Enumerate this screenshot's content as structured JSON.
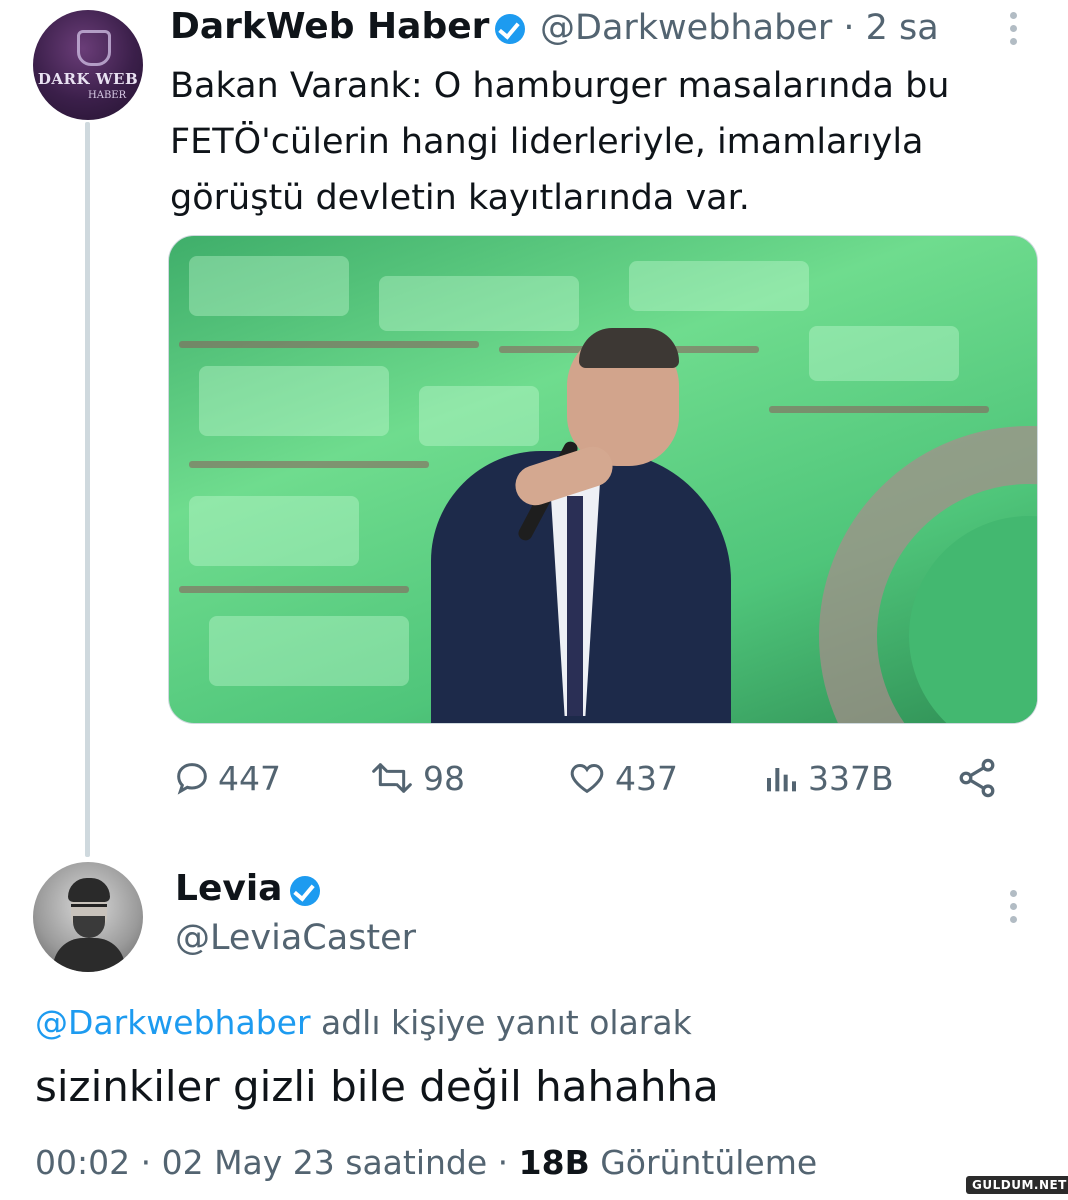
{
  "tweet": {
    "author_name": "DarkWeb Haber",
    "handle": "@Darkwebhaber",
    "time": "· 2 sa",
    "avatar_text": "DARK WEB",
    "avatar_sub": "HABER",
    "text": "Bakan Varank: O hamburger masalarında bu FETÖ'cülerin hangi liderleriyle, imamlarıyla görüştü devletin kayıtlarında var.",
    "stats": {
      "replies": "447",
      "retweets": "98",
      "likes": "437",
      "views": "337B"
    }
  },
  "reply": {
    "author_name": "Levia",
    "handle": "@LeviaCaster",
    "replying_to_mention": "@Darkwebhaber",
    "replying_to_suffix": " adlı kişiye yanıt olarak",
    "text": "sizinkiler gizli bile değil hahahha",
    "time": "00:02",
    "separator1": " · ",
    "date": "02 May 23 saatinde",
    "separator2": " · ",
    "views_count": "18B",
    "views_label": " Görüntüleme"
  },
  "watermark": "GULDUM.NET",
  "colors": {
    "verified": "#1d9bf0",
    "secondary_text": "#536471",
    "thread_line": "#cfd9de"
  }
}
